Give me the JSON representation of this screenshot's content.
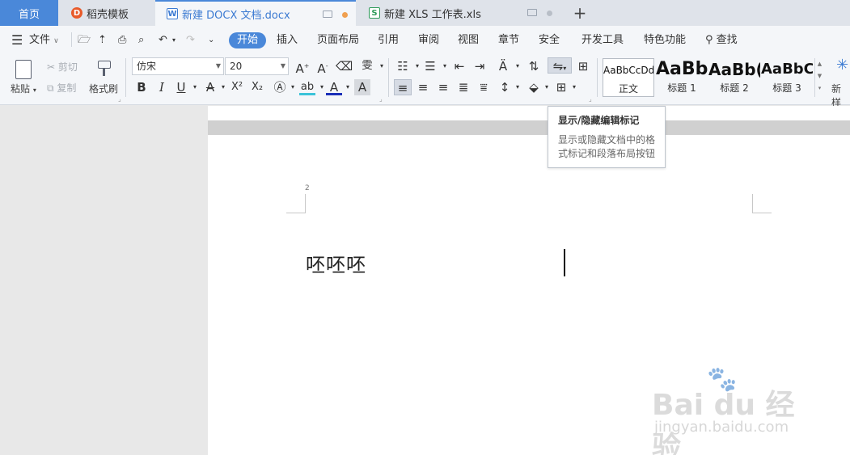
{
  "tabs": {
    "home": "首页",
    "daoke": "稻壳模板",
    "docx": "新建 DOCX 文档.docx",
    "xls": "新建 XLS 工作表.xls",
    "add": "+"
  },
  "menu": {
    "file": "文件",
    "start": "开始",
    "insert": "插入",
    "layout": "页面布局",
    "references": "引用",
    "review": "审阅",
    "view": "视图",
    "chapter": "章节",
    "security": "安全",
    "developer": "开发工具",
    "features": "特色功能",
    "search": "查找"
  },
  "ribbon": {
    "paste": "粘贴",
    "cut": "剪切",
    "copy": "复制",
    "format_painter": "格式刷",
    "font_name": "仿宋",
    "font_size": "20",
    "styles": [
      {
        "sample": "AaBbCcDd",
        "label": "正文"
      },
      {
        "sample": "AaBb",
        "label": "标题 1"
      },
      {
        "sample": "AaBb(",
        "label": "标题 2"
      },
      {
        "sample": "AaBbC(",
        "label": "标题 3"
      }
    ],
    "new_style": "新样"
  },
  "document": {
    "page_number": "2",
    "body_text": "呸呸呸"
  },
  "tooltip": {
    "title": "显示/隐藏编辑标记",
    "description": "显示或隐藏文档中的格式标记和段落布局按钮"
  },
  "watermark": {
    "main": "Bai du 经验",
    "sub": "jingyan.baidu.com"
  },
  "colors": {
    "accent": "#4a88d9",
    "active_tab_text": "#3b7ad2",
    "xls_green": "#2f9b5a",
    "modified_dot": "#f0a050"
  }
}
